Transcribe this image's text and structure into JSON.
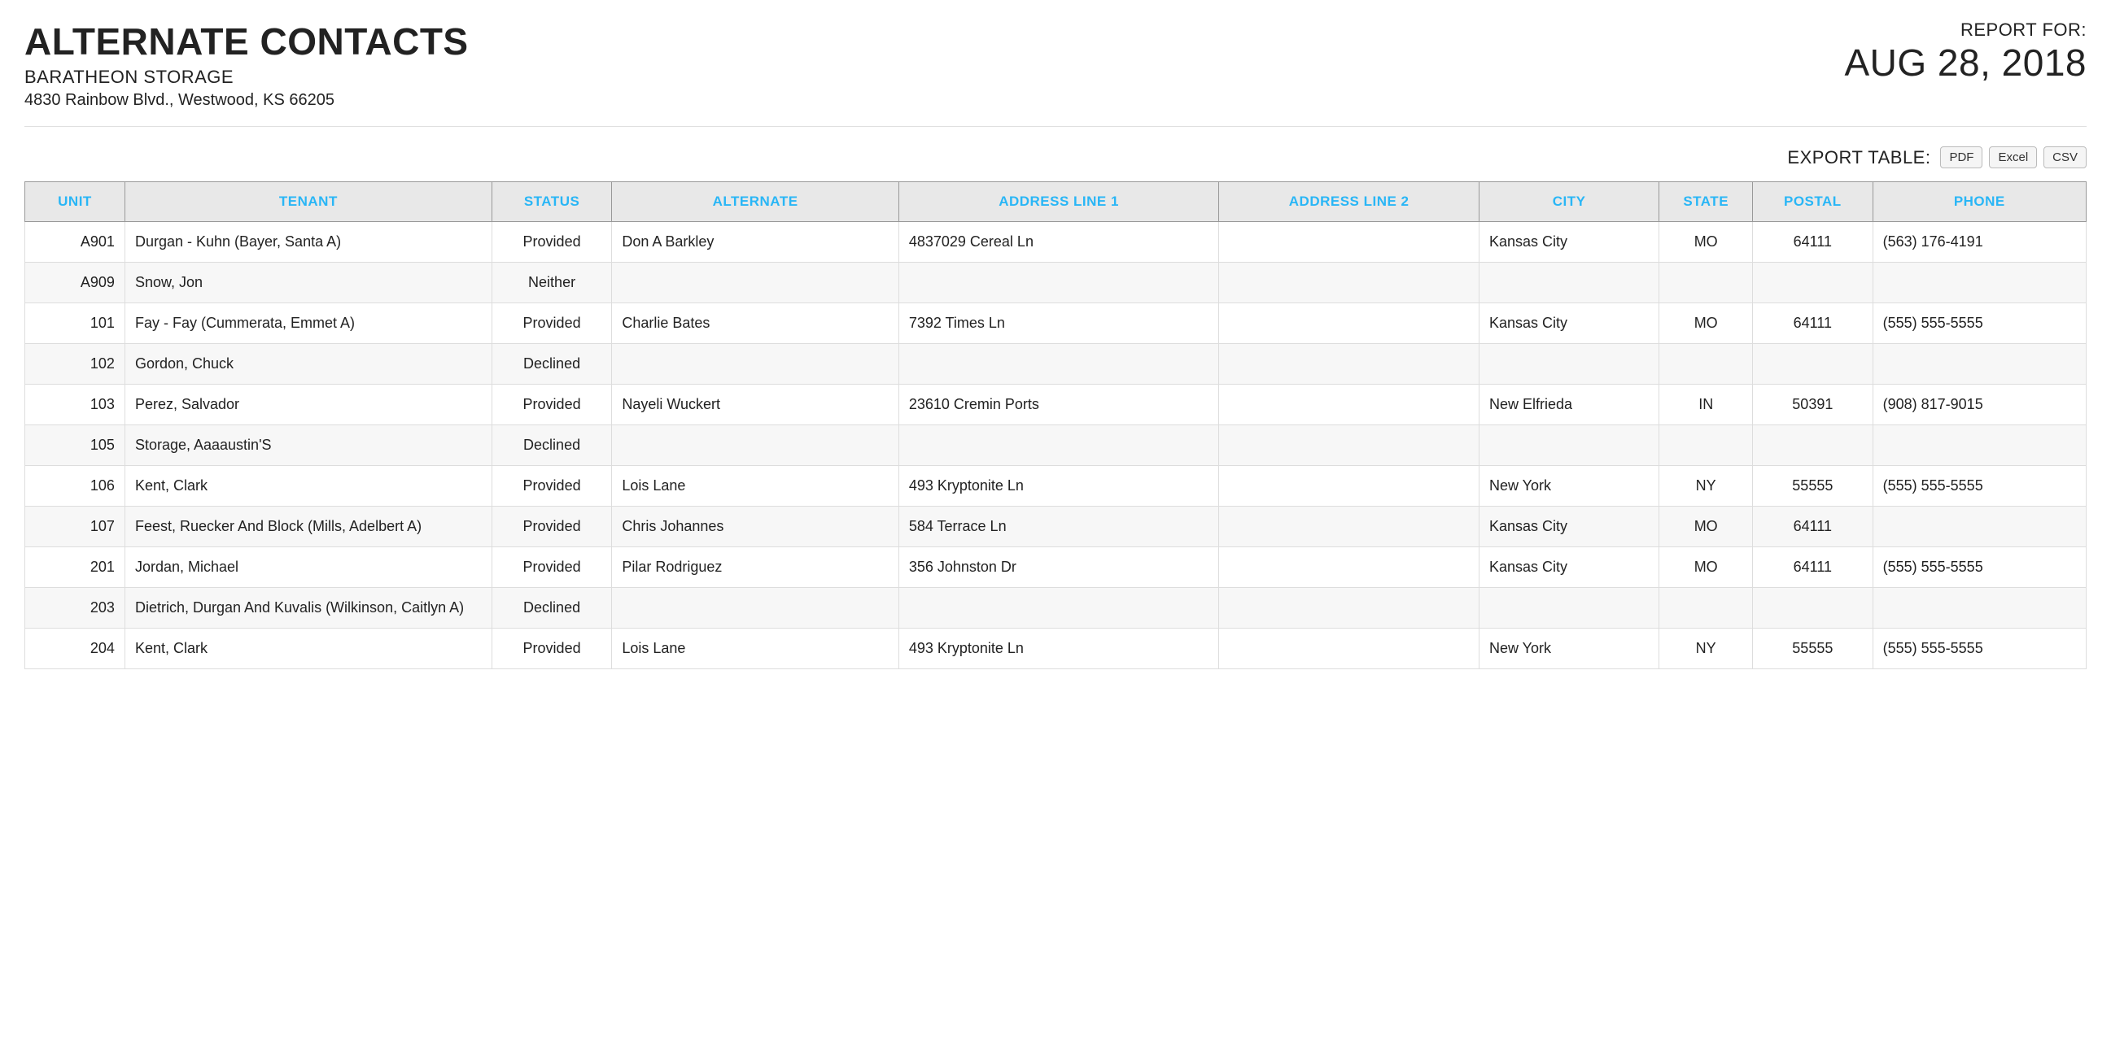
{
  "header": {
    "title": "ALTERNATE CONTACTS",
    "company": "BARATHEON STORAGE",
    "address": "4830 Rainbow Blvd., Westwood, KS 66205",
    "report_for_label": "REPORT FOR:",
    "report_date": "AUG 28, 2018"
  },
  "export": {
    "label": "EXPORT TABLE:",
    "buttons": {
      "pdf": "PDF",
      "excel": "Excel",
      "csv": "CSV"
    }
  },
  "table": {
    "columns": {
      "unit": "UNIT",
      "tenant": "TENANT",
      "status": "STATUS",
      "alternate": "ALTERNATE",
      "addr1": "ADDRESS LINE 1",
      "addr2": "ADDRESS LINE 2",
      "city": "CITY",
      "state": "STATE",
      "postal": "POSTAL",
      "phone": "PHONE"
    },
    "rows": [
      {
        "unit": "A901",
        "tenant": "Durgan - Kuhn (Bayer, Santa A)",
        "status": "Provided",
        "alternate": "Don A Barkley",
        "addr1": "4837029 Cereal Ln",
        "addr2": "",
        "city": "Kansas City",
        "state": "MO",
        "postal": "64111",
        "phone": "(563) 176-4191"
      },
      {
        "unit": "A909",
        "tenant": "Snow, Jon",
        "status": "Neither",
        "alternate": "",
        "addr1": "",
        "addr2": "",
        "city": "",
        "state": "",
        "postal": "",
        "phone": ""
      },
      {
        "unit": "101",
        "tenant": "Fay - Fay (Cummerata, Emmet A)",
        "status": "Provided",
        "alternate": "Charlie Bates",
        "addr1": "7392 Times Ln",
        "addr2": "",
        "city": "Kansas City",
        "state": "MO",
        "postal": "64111",
        "phone": "(555) 555-5555"
      },
      {
        "unit": "102",
        "tenant": "Gordon, Chuck",
        "status": "Declined",
        "alternate": "",
        "addr1": "",
        "addr2": "",
        "city": "",
        "state": "",
        "postal": "",
        "phone": ""
      },
      {
        "unit": "103",
        "tenant": "Perez, Salvador",
        "status": "Provided",
        "alternate": "Nayeli Wuckert",
        "addr1": "23610 Cremin Ports",
        "addr2": "",
        "city": "New Elfrieda",
        "state": "IN",
        "postal": "50391",
        "phone": "(908) 817-9015"
      },
      {
        "unit": "105",
        "tenant": "Storage, Aaaaustin'S",
        "status": "Declined",
        "alternate": "",
        "addr1": "",
        "addr2": "",
        "city": "",
        "state": "",
        "postal": "",
        "phone": ""
      },
      {
        "unit": "106",
        "tenant": "Kent, Clark",
        "status": "Provided",
        "alternate": "Lois Lane",
        "addr1": "493 Kryptonite Ln",
        "addr2": "",
        "city": "New York",
        "state": "NY",
        "postal": "55555",
        "phone": "(555) 555-5555"
      },
      {
        "unit": "107",
        "tenant": "Feest, Ruecker And Block (Mills, Adelbert A)",
        "status": "Provided",
        "alternate": "Chris Johannes",
        "addr1": "584 Terrace Ln",
        "addr2": "",
        "city": "Kansas City",
        "state": "MO",
        "postal": "64111",
        "phone": ""
      },
      {
        "unit": "201",
        "tenant": "Jordan, Michael",
        "status": "Provided",
        "alternate": "Pilar Rodriguez",
        "addr1": "356 Johnston Dr",
        "addr2": "",
        "city": "Kansas City",
        "state": "MO",
        "postal": "64111",
        "phone": "(555) 555-5555"
      },
      {
        "unit": "203",
        "tenant": "Dietrich, Durgan And Kuvalis (Wilkinson, Caitlyn A)",
        "status": "Declined",
        "alternate": "",
        "addr1": "",
        "addr2": "",
        "city": "",
        "state": "",
        "postal": "",
        "phone": ""
      },
      {
        "unit": "204",
        "tenant": "Kent, Clark",
        "status": "Provided",
        "alternate": "Lois Lane",
        "addr1": "493 Kryptonite Ln",
        "addr2": "",
        "city": "New York",
        "state": "NY",
        "postal": "55555",
        "phone": "(555) 555-5555"
      }
    ]
  }
}
